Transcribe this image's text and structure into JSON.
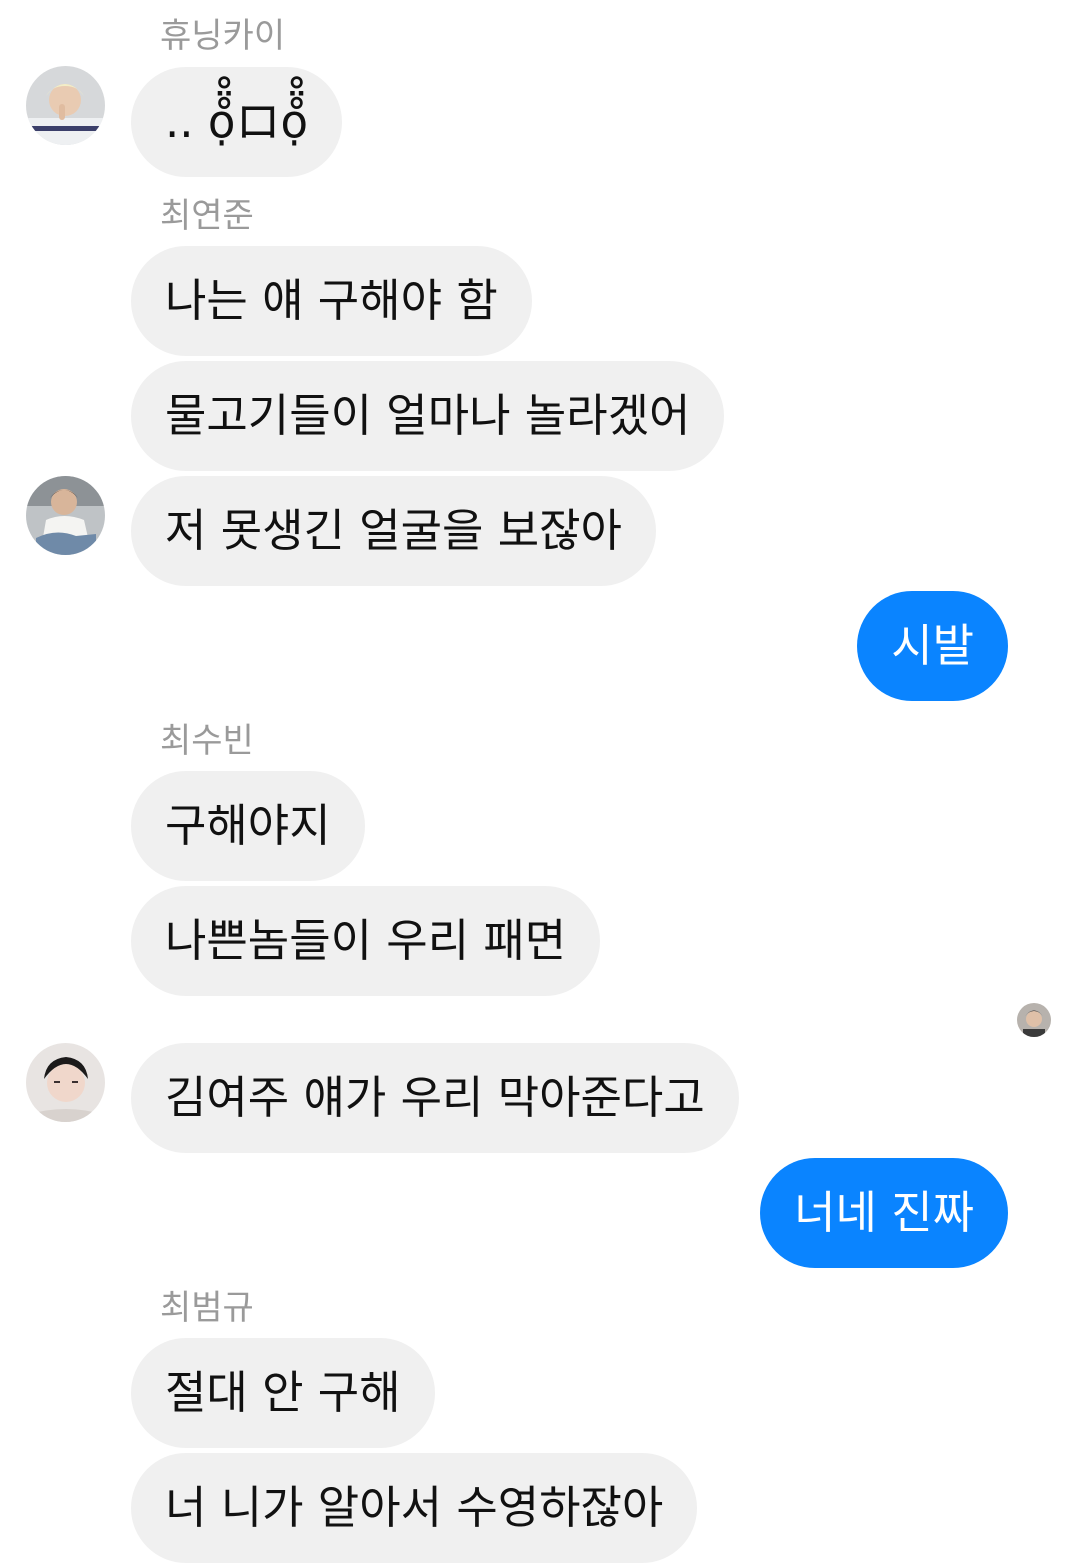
{
  "colors": {
    "incoming_bubble": "#f0f0f0",
    "outgoing_bubble": "#0a84ff",
    "sender_name": "#9a9a9a"
  },
  "messages": [
    {
      "sender": "휴닝카이",
      "text": ".. ọ̊̈̊ロọ̊̈̊"
    },
    {
      "sender": "최연준",
      "text": "나는 얘 구해야 함"
    },
    {
      "text": "물고기들이 얼마나 놀라겠어"
    },
    {
      "text": "저 못생긴 얼굴을 보잖아"
    },
    {
      "text": "시발"
    },
    {
      "sender": "최수빈",
      "text": "구해야지"
    },
    {
      "text": "나쁜놈들이 우리 패면"
    },
    {
      "text": "김여주 얘가 우리 막아준다고"
    },
    {
      "text": "너네 진짜"
    },
    {
      "sender": "최범규",
      "text": "절대 안 구해"
    },
    {
      "text": "너 니가 알아서 수영하잖아"
    }
  ]
}
